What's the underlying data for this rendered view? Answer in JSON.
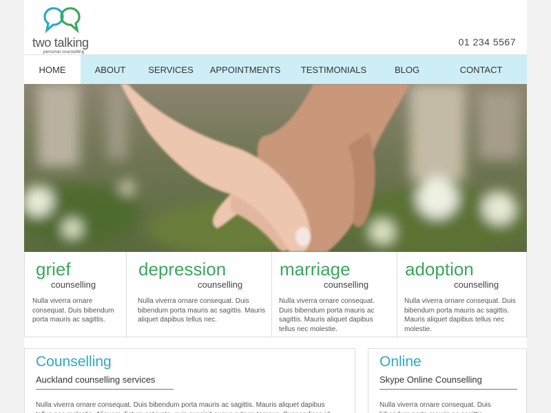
{
  "brand": {
    "name": "two talking",
    "tagline": "personal counselling",
    "colors": {
      "green": "#3aa75b",
      "teal": "#2ba9c4",
      "nav_bg": "#cdeef6"
    }
  },
  "header": {
    "phone": "01 234 5567"
  },
  "nav": {
    "items": [
      {
        "label": "HOME",
        "active": true
      },
      {
        "label": "ABOUT"
      },
      {
        "label": "SERVICES"
      },
      {
        "label": "APPOINTMENTS"
      },
      {
        "label": "TESTIMONIALS"
      },
      {
        "label": "BLOG"
      },
      {
        "label": "CONTACT"
      }
    ]
  },
  "hero": {
    "image": "holding-hands-photo"
  },
  "services": [
    {
      "title": "grief",
      "subtitle": "counselling",
      "text": "Nulla viverra ornare consequat. Duis bibendum porta mauris ac sagittis."
    },
    {
      "title": "depression",
      "subtitle": "counselling",
      "text": "Nulla viverra ornare consequat. Duis bibendum porta mauris ac sagittis. Mauris aliquet dapibus tellus nec."
    },
    {
      "title": "marriage",
      "subtitle": "counselling",
      "text": "Nulla viverra ornare consequat. Duis bibendum porta mauris ac sagittis. Mauris aliquet dapibus tellus nec molestie."
    },
    {
      "title": "adoption",
      "subtitle": "counselling",
      "text": "Nulla viverra ornare consequat. Duis bibendum porta mauris ac sagittis. Mauris aliquet dapibus tellus nec molestie."
    }
  ],
  "panels": {
    "counselling": {
      "title": "Counselling",
      "subtitle": "Auckland counselling services",
      "text": "Nulla viverra ornare consequat. Duis bibendum porta mauris ac sagittis. Mauris aliquet dapibus tellus nec molestie. Aliquam dictum est justo, quis suscipit augue rutrum tempus. Suspendisse id"
    },
    "online": {
      "title": "Online",
      "subtitle": "Skype Online Counselling",
      "text": "Nulla viverra ornare consequat. Duis bibendum porta mauris ac sagittis."
    }
  }
}
